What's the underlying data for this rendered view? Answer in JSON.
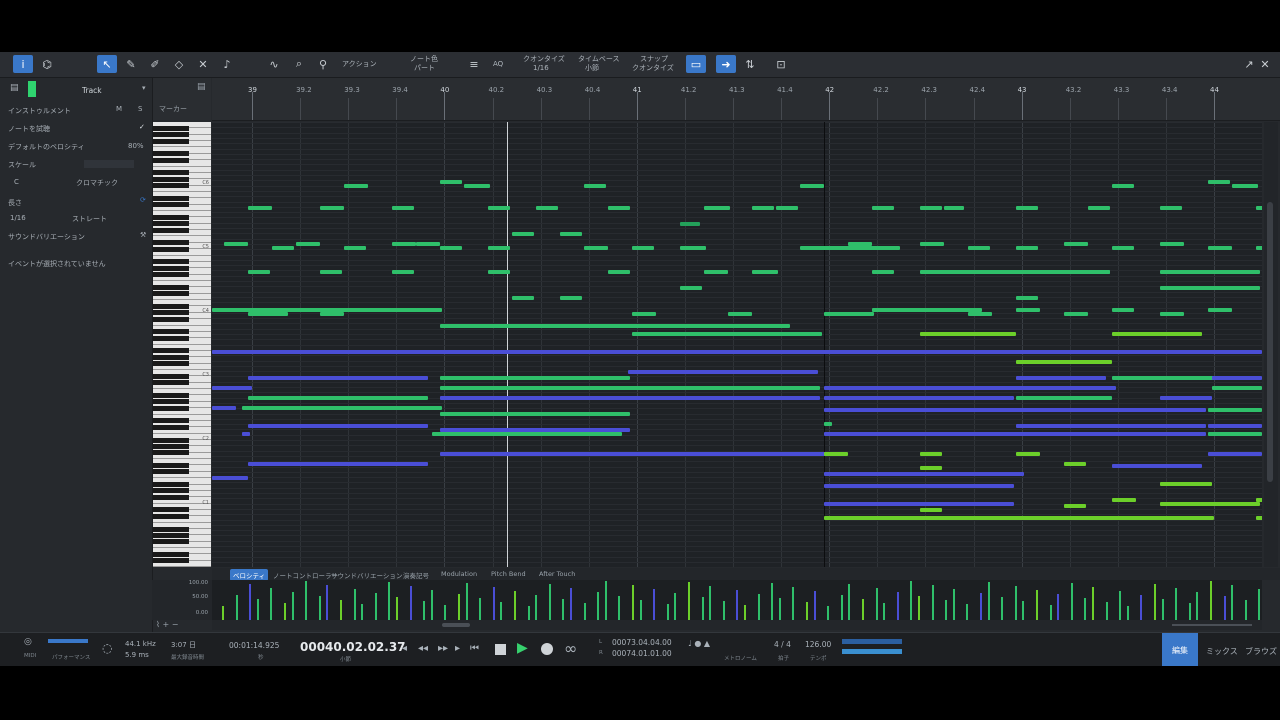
{
  "toolbar": {
    "action_label": "アクション",
    "note_color_label": "ノート色",
    "note_color_value": "パート",
    "aq_label": "AQ",
    "quantize_label": "クオンタイズ",
    "quantize_value": "1/16",
    "timebase_label": "タイムベース",
    "timebase_value": "小節",
    "snap_label": "スナップ",
    "snap_value": "クオンタイズ"
  },
  "inspector": {
    "track_label": "Track",
    "mute_label": "M",
    "solo_label": "S",
    "marker_label": "マーカー",
    "instrument_label": "インストゥルメント",
    "audition_label": "ノートを試聴",
    "default_velocity_label": "デフォルトのベロシティ",
    "default_velocity_value": "80%",
    "scale_label": "スケール",
    "scale_root": "C",
    "scale_type": "クロマチック",
    "length_label": "長さ",
    "length_value": "1/16",
    "length_mode": "ストレート",
    "sound_variation_label": "サウンドバリエーション",
    "no_event_label": "イベントが選択されていません"
  },
  "ruler": {
    "ticks": [
      "39",
      "39.2",
      "39.3",
      "39.4",
      "40",
      "40.2",
      "40.3",
      "40.4",
      "41",
      "41.2",
      "41.3",
      "41.4",
      "42",
      "42.2",
      "42.3",
      "42.4",
      "43",
      "43.2",
      "43.3",
      "43.4",
      "44"
    ]
  },
  "keyboard": {
    "c_labels": [
      "C6",
      "C5",
      "C4",
      "C3",
      "C2",
      "C1"
    ]
  },
  "controller": {
    "tabs": [
      "ベロシティ",
      "ノートコントローラー",
      "サウンドバリエーション",
      "演奏記号",
      "Modulation",
      "Pitch Bend",
      "After Touch"
    ],
    "axis": [
      "100.00",
      "50.00",
      "0.00"
    ]
  },
  "transport": {
    "midi_label": "MIDI",
    "performance_label": "パフォーマンス",
    "sample_rate": "44.1 kHz",
    "latency": "5.9 ms",
    "record_time": "3:07 日",
    "record_max_label": "最大録音時間",
    "seconds_time": "00:01:14.925",
    "seconds_label": "秒",
    "main_time": "00040.02.02.37",
    "bars_label": "小節",
    "loop_left": "00073.04.04.00",
    "loop_right": "00074.01.01.00",
    "loop_l_marker": "L",
    "loop_r_marker": "R",
    "metronome_label": "メトロノーム",
    "signature": "4 / 4",
    "signature_label": "拍子",
    "tempo": "126.00",
    "tempo_label": "テンポ",
    "tab_edit": "編集",
    "tab_mix": "ミックス",
    "tab_browse": "ブラウズ"
  },
  "colors": {
    "accent": "#3a78c9",
    "note_green": "#2fbf6a",
    "note_blue": "#4a4ed6",
    "note_lime": "#6ccf2a"
  }
}
